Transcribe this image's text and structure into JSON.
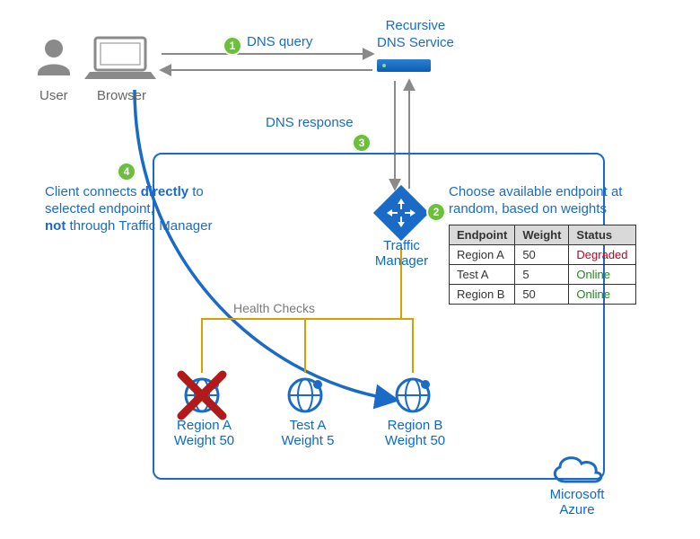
{
  "user": {
    "label": "User"
  },
  "browser": {
    "label": "Browser"
  },
  "dns_service": {
    "title_line1": "Recursive",
    "title_line2": "DNS Service"
  },
  "traffic_manager": {
    "label": "Traffic Manager"
  },
  "azure": {
    "label_line1": "Microsoft",
    "label_line2": "Azure"
  },
  "steps": {
    "1": {
      "num": "1",
      "text": "DNS query"
    },
    "2": {
      "num": "2",
      "text": "Choose available endpoint at random, based on weights"
    },
    "3": {
      "num": "3",
      "text": "DNS response"
    },
    "4": {
      "num": "4",
      "text_parts": [
        "Client connects ",
        "directly",
        " to selected endpoint, ",
        "not",
        " through Traffic Manager"
      ]
    }
  },
  "health_checks_label": "Health Checks",
  "endpoints_table": {
    "headers": [
      "Endpoint",
      "Weight",
      "Status"
    ],
    "rows": [
      {
        "endpoint": "Region A",
        "weight": "50",
        "status": "Degraded",
        "status_class": "status-degraded"
      },
      {
        "endpoint": "Test A",
        "weight": "5",
        "status": "Online",
        "status_class": "status-online"
      },
      {
        "endpoint": "Region B",
        "weight": "50",
        "status": "Online",
        "status_class": "status-online"
      }
    ]
  },
  "endpoints": [
    {
      "name": "Region A",
      "weight_label": "Weight 50",
      "failed": true
    },
    {
      "name": "Test A",
      "weight_label": "Weight 5",
      "failed": false
    },
    {
      "name": "Region B",
      "weight_label": "Weight 50",
      "failed": false
    }
  ],
  "colors": {
    "azure_blue": "#1a6bc7",
    "arrow_gray": "#8a8a8a",
    "hc_gold": "#d6a000",
    "fail_red": "#b21919",
    "badge_green": "#6bbf3a"
  }
}
